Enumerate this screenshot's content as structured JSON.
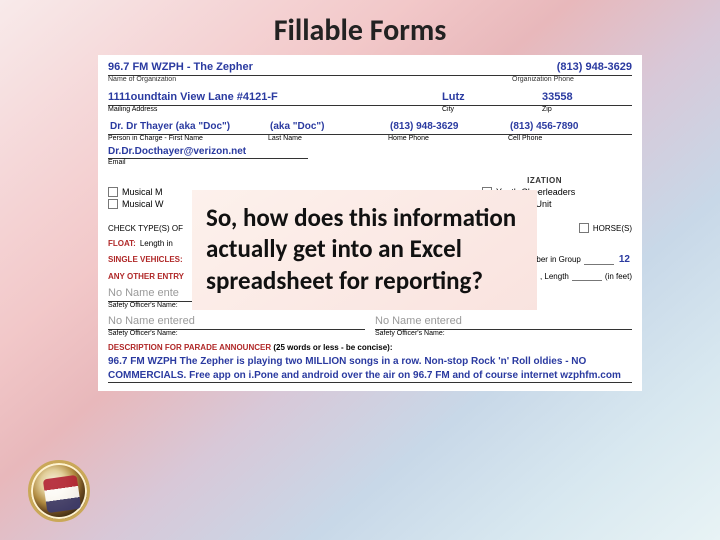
{
  "title": "Fillable Forms",
  "org": {
    "name": "96.7 FM WZPH - The Zepher",
    "phone": "(813) 948-3629",
    "name_label": "Name of Organization",
    "phone_label": "Organization Phone"
  },
  "address": {
    "street": "1111oundtain View Lane #4121-F",
    "city": "Lutz",
    "zip": "33558",
    "street_label": "Mailing Address",
    "city_label": "City",
    "zip_label": "Zip"
  },
  "person": {
    "first": "Dr. Dr Thayer (aka \"Doc\")",
    "last": "(aka \"Doc\")",
    "home_phone": "(813) 948-3629",
    "cell_phone": "(813) 456-7890",
    "first_label": "Person in Charge - First Name",
    "last_label": "Last Name",
    "home_label": "Home Phone",
    "cell_label": "Cell Phone"
  },
  "email": {
    "value": "Dr.Dr.Docthayer@verizon.net",
    "label": "Email"
  },
  "music": {
    "heading": "IZATION",
    "row1_left": "Musical M",
    "row1_right": "Youth Cheerleaders",
    "row2_left": "Musical W",
    "row2_right": "Marching Unit"
  },
  "check": {
    "label": "CHECK TYPE(S) OF",
    "horses": "HORSE(S)"
  },
  "float": {
    "label": "FLOAT:",
    "length": "Length in"
  },
  "single_vehicles": {
    "label": "SINGLE VEHICLES:",
    "num_group_label": "nber in Group",
    "num_group_value": "12"
  },
  "any_other": {
    "label": "ANY OTHER ENTRY",
    "length_label": ", Length",
    "feet": "(in feet)"
  },
  "sig1": {
    "left_value": "No Name ente",
    "left_label": "Safety Officer's Name:"
  },
  "sig2": {
    "left_value": "No Name entered",
    "right_value": "No Name entered",
    "left_label": "Safety Officer's Name:",
    "right_label": "Safety Officer's Name:"
  },
  "announcer": {
    "label": "DESCRIPTION FOR PARADE ANNOUNCER",
    "hint": "(25 words or less - be concise):",
    "text": "96.7 FM WZPH The Zepher is playing two MILLION songs in a row.  Non-stop Rock 'n' Roll oldies - NO COMMERCIALS.  Free app on i.Pone and android over the air on 96.7 FM and of course internet wzphfm.com"
  },
  "overlay": {
    "question": "So, how does this information actually get into an Excel spreadsheet  for reporting?"
  }
}
